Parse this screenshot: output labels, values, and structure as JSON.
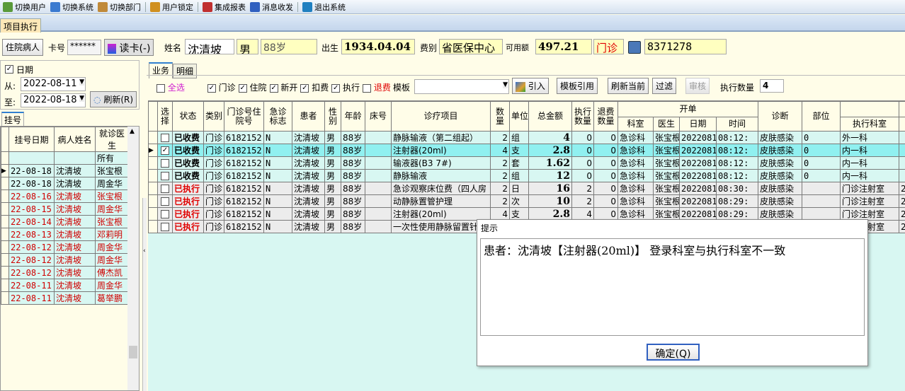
{
  "toolbar": {
    "items": [
      {
        "label": "切换用户",
        "icon": "switch-user-icon",
        "color": "#5a9a3a"
      },
      {
        "label": "切换系统",
        "icon": "switch-system-icon",
        "color": "#3a7ad0"
      },
      {
        "label": "切换部门",
        "icon": "switch-dept-icon",
        "color": "#c08a3a"
      },
      {
        "label": "用户锁定",
        "icon": "lock-user-icon",
        "color": "#d09020"
      },
      {
        "label": "集成报表",
        "icon": "report-icon",
        "color": "#c03030"
      },
      {
        "label": "消息收发",
        "icon": "info-icon",
        "color": "#3060c0"
      },
      {
        "label": "退出系统",
        "icon": "exit-icon",
        "color": "#2080c0"
      }
    ]
  },
  "tab": "项目执行",
  "patient": {
    "type_btn": "住院病人",
    "card_label": "卡号",
    "card_no": "******",
    "read_card": "读卡(-)",
    "name_label": "姓名",
    "name": "沈清坡",
    "sex": "男",
    "age": "88岁",
    "birth_label": "出生",
    "birth": "1934.04.04",
    "fee_label": "费别",
    "fee": "省医保中心",
    "avail_label": "可用额",
    "avail": "497.21",
    "visit_type": "门诊",
    "visit_no": "8371278"
  },
  "filter": {
    "date_label": "日期",
    "date_checked": true,
    "from_label": "从:",
    "from": "2022-08-11",
    "to_label": "至:",
    "to": "2022-08-18",
    "refresh": "刷新(R)"
  },
  "reg": {
    "tab": "挂号",
    "headers": [
      "挂号日期",
      "病人姓名",
      "就诊医生"
    ],
    "all": "所有",
    "rows": [
      [
        "22-08-18",
        "沈清坡",
        "张宝根",
        false
      ],
      [
        "22-08-18",
        "沈清坡",
        "周金华",
        false
      ],
      [
        "22-08-16",
        "沈清坡",
        "张宝根",
        true
      ],
      [
        "22-08-15",
        "沈清坡",
        "周金华",
        true
      ],
      [
        "22-08-14",
        "沈清坡",
        "张宝根",
        true
      ],
      [
        "22-08-13",
        "沈清坡",
        "邓莉明",
        true
      ],
      [
        "22-08-12",
        "沈清坡",
        "周金华",
        true
      ],
      [
        "22-08-12",
        "沈清坡",
        "周金华",
        true
      ],
      [
        "22-08-12",
        "沈清坡",
        "傅杰凯",
        true
      ],
      [
        "22-08-11",
        "沈清坡",
        "周金华",
        true
      ],
      [
        "22-08-11",
        "沈清坡",
        "葛举鹏",
        true
      ]
    ]
  },
  "main": {
    "tabs": [
      "业务",
      "明细"
    ],
    "opts": [
      {
        "label": "全选",
        "checked": false,
        "color": "#d020d0"
      },
      {
        "label": "门诊",
        "checked": true
      },
      {
        "label": "住院",
        "checked": true
      },
      {
        "label": "新开",
        "checked": true
      },
      {
        "label": "扣费",
        "checked": true
      },
      {
        "label": "执行",
        "checked": true
      },
      {
        "label": "退费",
        "checked": false,
        "color": "#e00000"
      }
    ],
    "template_label": "模板",
    "template": "",
    "btns": [
      "引入",
      "模板引用",
      "刷新当前",
      "过滤",
      "审核"
    ],
    "exec_qty_label": "执行数量",
    "exec_qty": "4"
  },
  "grid": {
    "headers": {
      "sel": "选择",
      "status": "状态",
      "cat": "类别",
      "no": "门诊号住院号",
      "emerg": "急诊标志",
      "patient": "患者",
      "sex": "性别",
      "age": "年龄",
      "bed": "床号",
      "item": "诊疗项目",
      "qty": "数量",
      "unit": "单位",
      "total": "总金额",
      "exec_qty": "执行数量",
      "ref_qty": "退费数量",
      "order": "开单",
      "dept": "科室",
      "doctor": "医生",
      "date": "日期",
      "time": "时间",
      "diag": "诊断",
      "site": "部位",
      "exec_dept": "执行科室"
    },
    "rows": [
      {
        "sel": false,
        "status": "已收费",
        "cat": "门诊",
        "no": "6182152",
        "emerg": "N",
        "patient": "沈清坡",
        "sex": "男",
        "age": "88岁",
        "bed": "",
        "item": "静脉输液（第二组起）",
        "qty": "2",
        "unit": "组",
        "total": "4",
        "exec": "0",
        "ref": "0",
        "dept": "急诊科",
        "doctor": "张宝根",
        "date": "20220818",
        "time": "08:12:",
        "diag": "皮肤感染",
        "site": "0",
        "exec_dept": "外一科",
        "extra": ""
      },
      {
        "sel": true,
        "status": "已收费",
        "cat": "门诊",
        "no": "6182152",
        "emerg": "N",
        "patient": "沈清坡",
        "sex": "男",
        "age": "88岁",
        "bed": "",
        "item": "注射器(20ml)",
        "qty": "4",
        "unit": "支",
        "total": "2.8",
        "exec": "0",
        "ref": "0",
        "dept": "急诊科",
        "doctor": "张宝根",
        "date": "20220818",
        "time": "08:12:",
        "diag": "皮肤感染",
        "site": "0",
        "exec_dept": "内一科",
        "extra": ""
      },
      {
        "sel": false,
        "status": "已收费",
        "cat": "门诊",
        "no": "6182152",
        "emerg": "N",
        "patient": "沈清坡",
        "sex": "男",
        "age": "88岁",
        "bed": "",
        "item": "输液器(B3 7#)",
        "qty": "2",
        "unit": "套",
        "total": "1.62",
        "exec": "0",
        "ref": "0",
        "dept": "急诊科",
        "doctor": "张宝根",
        "date": "20220818",
        "time": "08:12:",
        "diag": "皮肤感染",
        "site": "0",
        "exec_dept": "内一科",
        "extra": ""
      },
      {
        "sel": false,
        "status": "已收费",
        "cat": "门诊",
        "no": "6182152",
        "emerg": "N",
        "patient": "沈清坡",
        "sex": "男",
        "age": "88岁",
        "bed": "",
        "item": "静脉输液",
        "qty": "2",
        "unit": "组",
        "total": "12",
        "exec": "0",
        "ref": "0",
        "dept": "急诊科",
        "doctor": "张宝根",
        "date": "20220818",
        "time": "08:12:",
        "diag": "皮肤感染",
        "site": "0",
        "exec_dept": "内一科",
        "extra": ""
      },
      {
        "sel": false,
        "status": "已执行",
        "cat": "门诊",
        "no": "6182152",
        "emerg": "N",
        "patient": "沈清坡",
        "sex": "男",
        "age": "88岁",
        "bed": "",
        "item": "急诊观察床位费（四人房",
        "qty": "2",
        "unit": "日",
        "total": "16",
        "exec": "2",
        "ref": "0",
        "dept": "急诊科",
        "doctor": "张宝根",
        "date": "20220818",
        "time": "08:30:",
        "diag": "皮肤感染",
        "site": "",
        "exec_dept": "门诊注射室",
        "extra": "2"
      },
      {
        "sel": false,
        "status": "已执行",
        "cat": "门诊",
        "no": "6182152",
        "emerg": "N",
        "patient": "沈清坡",
        "sex": "男",
        "age": "88岁",
        "bed": "",
        "item": "动静脉置管护理",
        "qty": "2",
        "unit": "次",
        "total": "10",
        "exec": "2",
        "ref": "0",
        "dept": "急诊科",
        "doctor": "张宝根",
        "date": "20220818",
        "time": "08:29:",
        "diag": "皮肤感染",
        "site": "",
        "exec_dept": "门诊注射室",
        "extra": "2"
      },
      {
        "sel": false,
        "status": "已执行",
        "cat": "门诊",
        "no": "6182152",
        "emerg": "N",
        "patient": "沈清坡",
        "sex": "男",
        "age": "88岁",
        "bed": "",
        "item": "注射器(20ml)",
        "qty": "4",
        "unit": "支",
        "total": "2.8",
        "exec": "4",
        "ref": "0",
        "dept": "急诊科",
        "doctor": "张宝根",
        "date": "20220818",
        "time": "08:29:",
        "diag": "皮肤感染",
        "site": "",
        "exec_dept": "门诊注射室",
        "extra": "2"
      },
      {
        "sel": false,
        "status": "已执行",
        "cat": "门诊",
        "no": "6182152",
        "emerg": "N",
        "patient": "沈清坡",
        "sex": "男",
        "age": "88岁",
        "bed": "",
        "item": "一次性使用静脉留置针",
        "qty": "",
        "unit": "",
        "total": "",
        "exec": "",
        "ref": "",
        "dept": "",
        "doctor": "",
        "date": "",
        "time": "",
        "diag": "",
        "site": "",
        "exec_dept": "门诊注射室",
        "extra": "2"
      }
    ]
  },
  "dialog": {
    "title": "提示",
    "message": "患者：沈清坡【注射器(20ml)】 登录科室与执行科室不一致",
    "ok": "确定(Q)"
  }
}
